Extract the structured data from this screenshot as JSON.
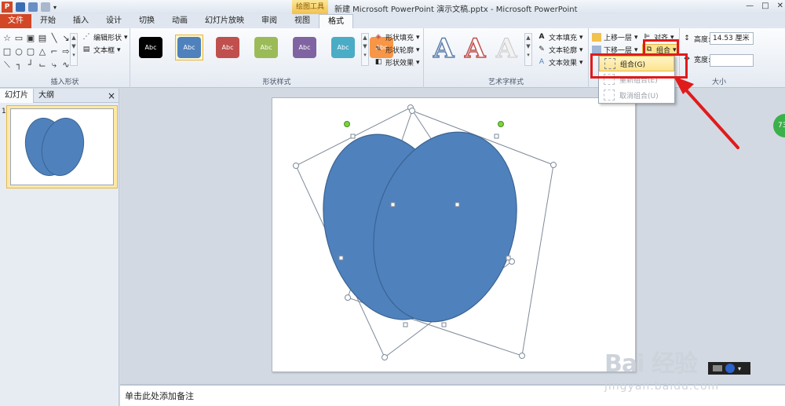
{
  "window": {
    "title": "新建 Microsoft PowerPoint 演示文稿.pptx - Microsoft PowerPoint",
    "context_tool": "绘图工具"
  },
  "tabs": [
    "文件",
    "开始",
    "插入",
    "设计",
    "切换",
    "动画",
    "幻灯片放映",
    "审阅",
    "视图",
    "格式"
  ],
  "ribbon": {
    "insert_shapes": {
      "label": "插入形状",
      "edit_shape": "编辑形状",
      "text_box": "文本框"
    },
    "shape_styles": {
      "label": "形状样式",
      "sample_text": "Abc",
      "fill": "形状填充",
      "outline": "形状轮廓",
      "effects": "形状效果",
      "colors": [
        "#000000",
        "#4f81bd",
        "#c0504d",
        "#9bbb59",
        "#8064a2",
        "#4bacc6",
        "#f79646"
      ]
    },
    "wordart": {
      "label": "艺术字样式",
      "letter": "A",
      "text_fill": "文本填充",
      "text_outline": "文本轮廓",
      "text_effects": "文本效果"
    },
    "arrange": {
      "bring_forward": "上移一层",
      "send_backward": "下移一层",
      "align": "对齐",
      "group": "组合"
    },
    "size": {
      "label": "大小",
      "height_label": "高度:",
      "height_value": "14.53 厘米",
      "width_label": "宽度:"
    }
  },
  "group_menu": {
    "items": [
      {
        "label": "组合(G)",
        "state": "highlighted"
      },
      {
        "label": "重新组合(E)",
        "state": "disabled"
      },
      {
        "label": "取消组合(U)",
        "state": "disabled"
      }
    ]
  },
  "left_panel": {
    "tabs": [
      "幻灯片",
      "大纲"
    ],
    "close": "×",
    "slide_number": "1"
  },
  "notes": {
    "placeholder": "单击此处添加备注"
  },
  "watermark": {
    "brand": "Bai 经验",
    "url": "jingyan.baidu.com"
  },
  "colors": {
    "file_tab": "#d24726",
    "shape_fill": "#4f81bd",
    "highlight": "#e01b1b"
  }
}
